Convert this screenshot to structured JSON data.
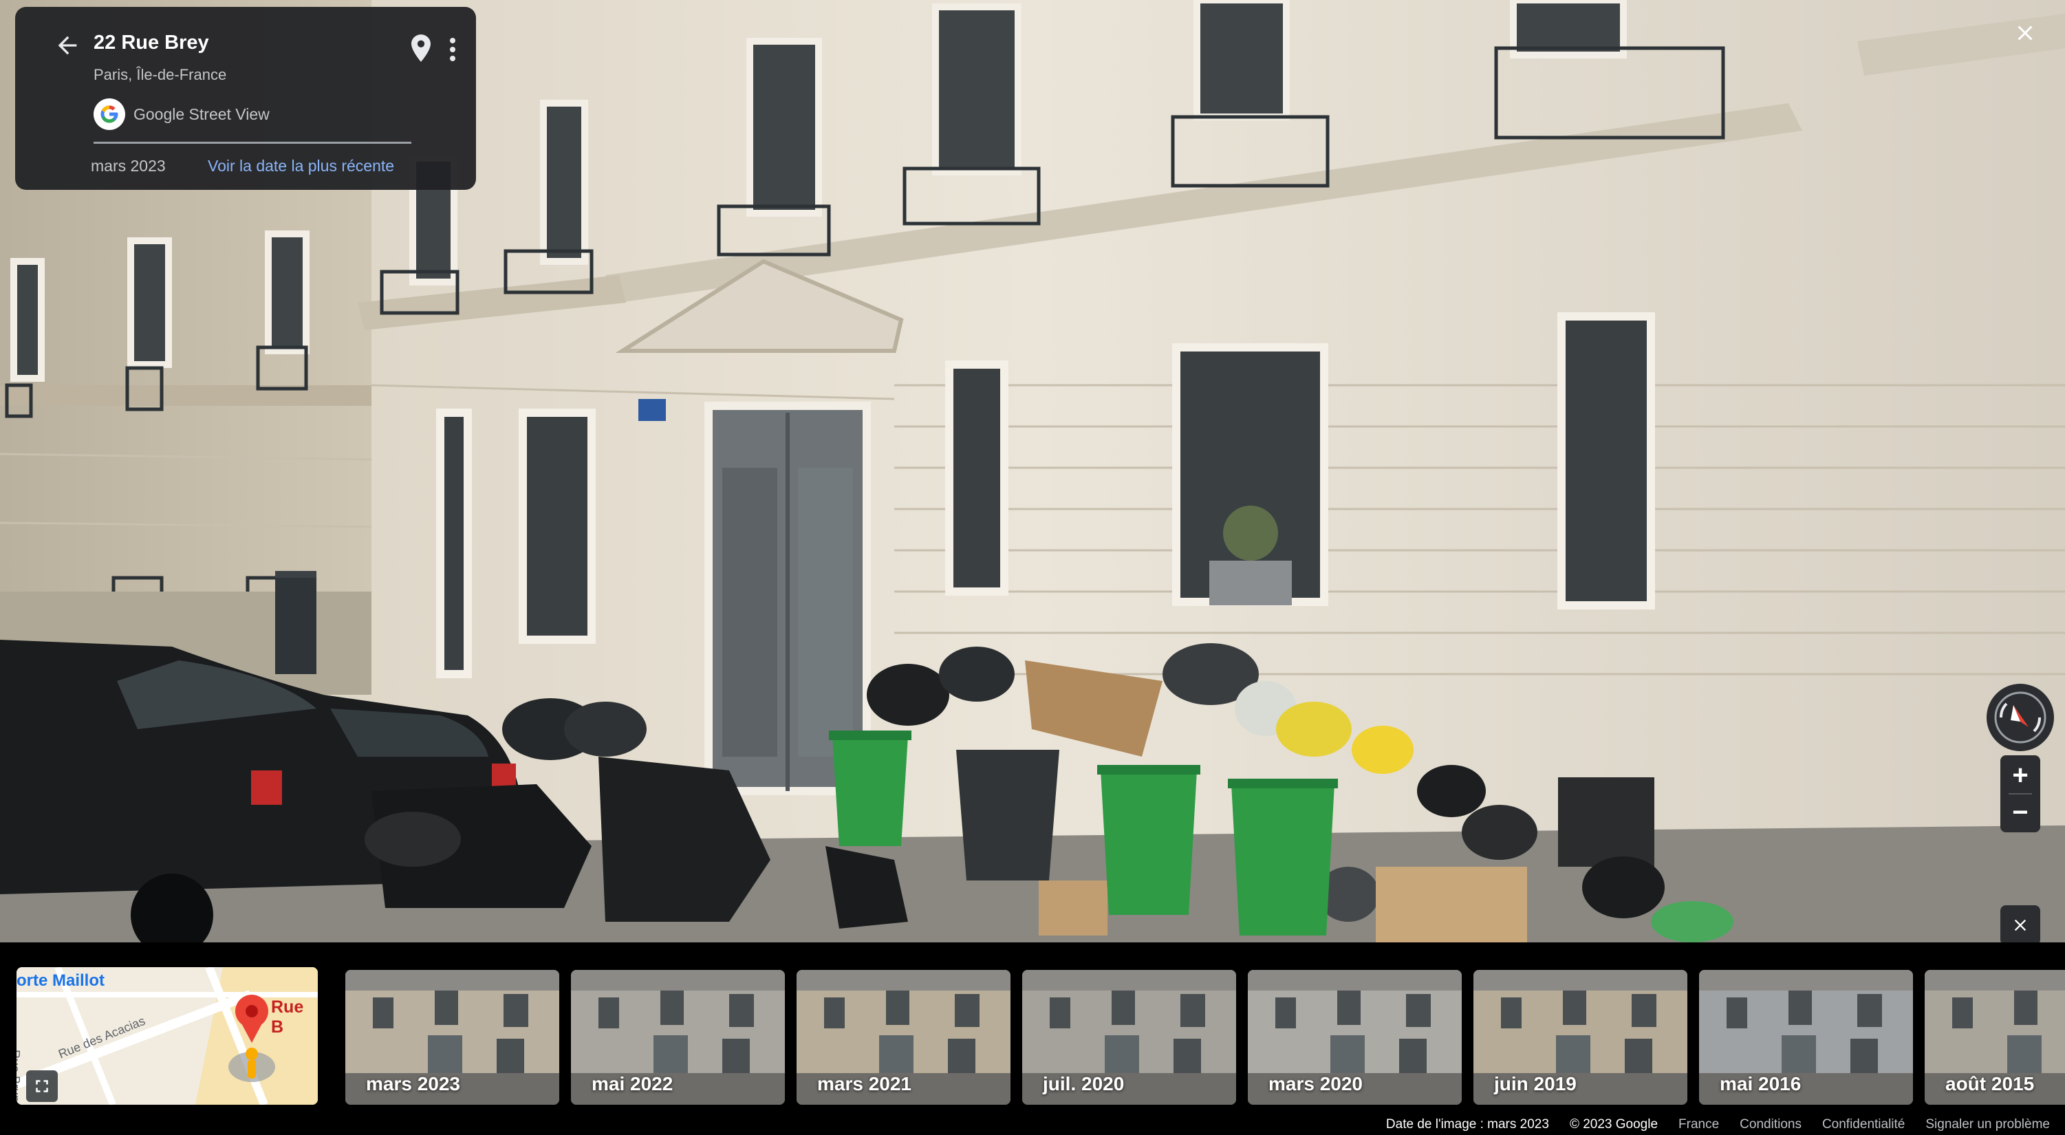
{
  "info_card": {
    "title": "22 Rue Brey",
    "subtitle": "Paris, Île-de-France",
    "source": "Google Street View",
    "current_date": "mars 2023",
    "latest_link": "Voir la date la plus récente"
  },
  "icons": {
    "back": "arrow-left-icon",
    "pin": "map-pin-icon",
    "more": "more-vert-icon",
    "close": "close-icon",
    "compass": "compass-icon",
    "expand": "fullscreen-icon"
  },
  "controls": {
    "zoom_in": "+",
    "zoom_out": "−"
  },
  "minimap": {
    "place": "orte Maillot",
    "street_1": "Rue des Acacias",
    "street_2": "Rue Brunel",
    "marker_label": "Rue B"
  },
  "timeline": [
    {
      "label": "mars 2023",
      "selected": true
    },
    {
      "label": "mai 2022",
      "selected": false
    },
    {
      "label": "mars 2021",
      "selected": false
    },
    {
      "label": "juil. 2020",
      "selected": false
    },
    {
      "label": "mars 2020",
      "selected": false
    },
    {
      "label": "juin 2019",
      "selected": false
    },
    {
      "label": "mai 2016",
      "selected": false
    },
    {
      "label": "août 2015",
      "selected": false
    }
  ],
  "footer": {
    "image_date": "Date de l'image : mars 2023",
    "copyright": "© 2023 Google",
    "country": "France",
    "terms": "Conditions",
    "privacy": "Confidentialité",
    "report": "Signaler un problème"
  },
  "colors": {
    "accent": "#4285f4",
    "link": "#8ab4f8",
    "card_bg": "#202124",
    "facade": "#e6e0d4",
    "bin_green": "#2f9b45"
  }
}
